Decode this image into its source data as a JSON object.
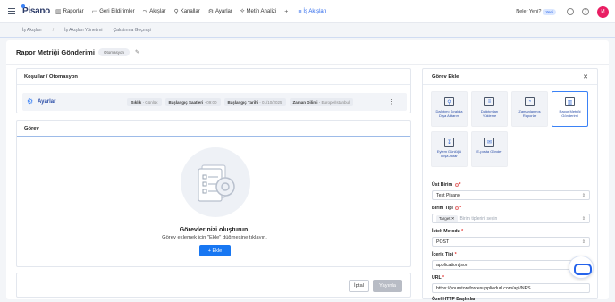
{
  "app": {
    "logo": "Pisano"
  },
  "nav": [
    {
      "icon": "▥",
      "label": "Raporlar"
    },
    {
      "icon": "▭",
      "label": "Geri Bildirimler"
    },
    {
      "icon": "⤳",
      "label": "Akışlar"
    },
    {
      "icon": "⚲",
      "label": "Kanallar"
    },
    {
      "icon": "⚙",
      "label": "Ayarlar"
    },
    {
      "icon": "⟡",
      "label": "Metin Analizi"
    },
    {
      "icon": "+",
      "label": ""
    },
    {
      "icon": "≡",
      "label": "İş Akışları"
    }
  ],
  "topright": {
    "whats_new": "Neler Yeni?",
    "new_badge": "Yeni",
    "avatar": "M"
  },
  "breadcrumb": [
    "İş Akışları",
    "/",
    "İş Akışları Yönetimi",
    "Çalıştırma Geçmişi"
  ],
  "header": {
    "title": "Rapor Metriği Gönderimi",
    "status": "Otomasyon"
  },
  "conditions": {
    "title": "Koşullar / Otomasyon",
    "row_label": "Ayarlar",
    "chips": [
      {
        "label": "Sıklık",
        "value": "Günlük"
      },
      {
        "label": "Başlangıç Saatleri",
        "value": "09:00"
      },
      {
        "label": "Başlangıç Tarihi",
        "value": "01/10/2025"
      },
      {
        "label": "Zaman Dilimi",
        "value": "Europe/Istanbul"
      }
    ]
  },
  "task": {
    "title": "Görev",
    "empty_title": "Görevlerinizi oluşturun.",
    "empty_sub": "Görev eklemek için \"Ekle\" düğmesine tıklayın.",
    "add_button": "+  Ekle"
  },
  "footer": {
    "cancel": "İptal",
    "publish": "Yayınla"
  },
  "panel": {
    "title": "Görev Ekle",
    "tiles": [
      {
        "icon": "chart-icon",
        "label": "Dağıtımı Sıralığa Dışa Aktarım"
      },
      {
        "icon": "list-icon",
        "label": "Dağıtımları Yükleme"
      },
      {
        "icon": "schedule-icon",
        "label": "Zamanlanmış Raporlar"
      },
      {
        "icon": "metric-icon",
        "label": "Rapor Metriği Gönderimi"
      },
      {
        "icon": "log-icon",
        "label": "Eylem Günlüğü Dışa Aktar"
      },
      {
        "icon": "email-icon",
        "label": "E-posta Gönder"
      }
    ],
    "fields": {
      "ust_birim_label": "Üst Birim",
      "ust_birim_value": "Test Pisano",
      "birim_tipi_label": "Birim Tipi",
      "birim_tipi_tag": "Target",
      "birim_tipi_placeholder": "Birim tiplerini seçin",
      "istek_metodu_label": "İstek Metodu",
      "istek_metodu_value": "POST",
      "icerik_tipi_label": "İçerik Tipi",
      "icerik_tipi_value": "application/json",
      "url_label": "URL",
      "url_value": "https://yourstoreforcesuppliedurl.com/api/NPS",
      "ozel_label": "Özel HTTP Başlıkları"
    }
  }
}
